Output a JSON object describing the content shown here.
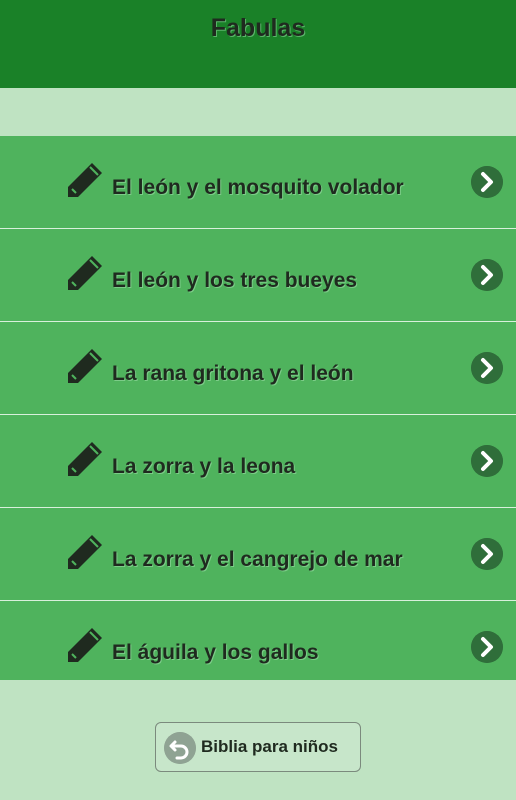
{
  "header": {
    "title": "Fabulas"
  },
  "list": {
    "items": [
      {
        "label": "El león y el mosquito volador"
      },
      {
        "label": "El león y los tres bueyes"
      },
      {
        "label": "La rana gritona y el león"
      },
      {
        "label": "La zorra y la leona"
      },
      {
        "label": "La zorra y el cangrejo de mar"
      },
      {
        "label": "El águila y los gallos"
      }
    ],
    "item_icon": "pencil-icon",
    "item_action_icon": "chevron-right-icon"
  },
  "footer": {
    "button_label": "Biblia para niños",
    "button_icon": "back-arrow-icon"
  },
  "colors": {
    "header_bg": "#1a8128",
    "item_bg": "#4fb35d",
    "page_bg": "#bfe3c2"
  }
}
